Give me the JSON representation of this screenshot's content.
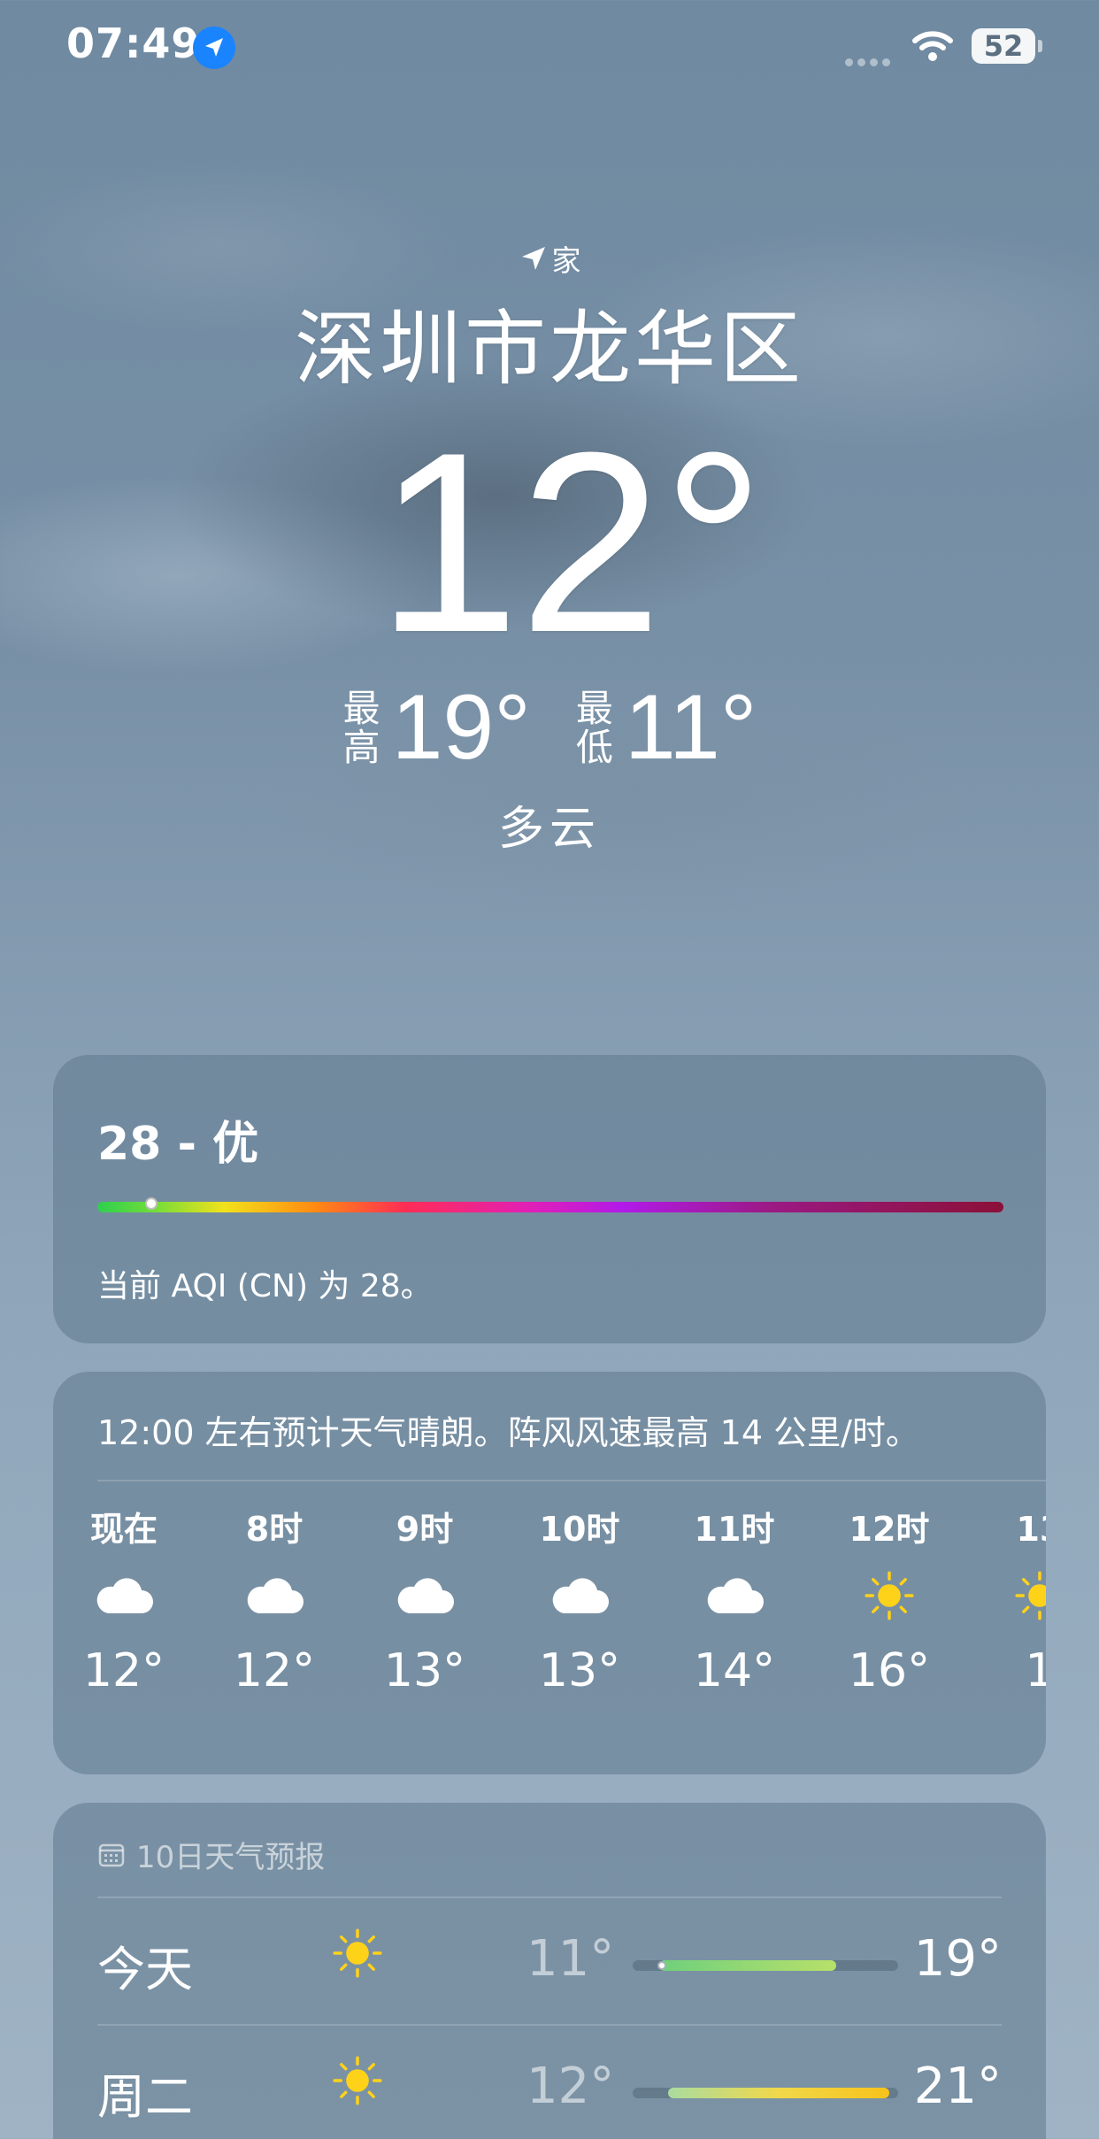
{
  "status_bar": {
    "time": "07:49",
    "battery": "52",
    "icons": [
      "location-arrow-icon",
      "signal-dots-icon",
      "wifi-icon",
      "battery-icon"
    ]
  },
  "header": {
    "location_label": "家",
    "city": "深圳市龙华区",
    "temperature": "12°",
    "high_label": "最高",
    "high": "19°",
    "low_label": "最低",
    "low": "11°",
    "condition": "多云"
  },
  "aqi": {
    "value_label": "28 - 优",
    "description": "当前 AQI (CN) 为 28。",
    "level_fraction": 0.06
  },
  "hourly": {
    "summary": "12:00 左右预计天气晴朗。阵风风速最高 14 公里/时。",
    "items": [
      {
        "hour": "现在",
        "icon": "cloud-icon",
        "temp": "12°"
      },
      {
        "hour": "8时",
        "icon": "cloud-icon",
        "temp": "12°"
      },
      {
        "hour": "9时",
        "icon": "cloud-icon",
        "temp": "13°"
      },
      {
        "hour": "10时",
        "icon": "cloud-icon",
        "temp": "13°"
      },
      {
        "hour": "11时",
        "icon": "cloud-icon",
        "temp": "14°"
      },
      {
        "hour": "12时",
        "icon": "sun-icon",
        "temp": "16°"
      },
      {
        "hour": "13",
        "icon": "sun-icon",
        "temp": "1"
      }
    ]
  },
  "daily": {
    "title": "10日天气预报",
    "days": [
      {
        "name": "今天",
        "icon": "sun-icon",
        "low": "11°",
        "high": "19°"
      },
      {
        "name": "周二",
        "icon": "sun-icon",
        "low": "12°",
        "high": "21°"
      }
    ]
  },
  "colors": {
    "card_bg": "#5f788c",
    "sun": "#ffd21a",
    "location_badge": "#1a84ff"
  }
}
